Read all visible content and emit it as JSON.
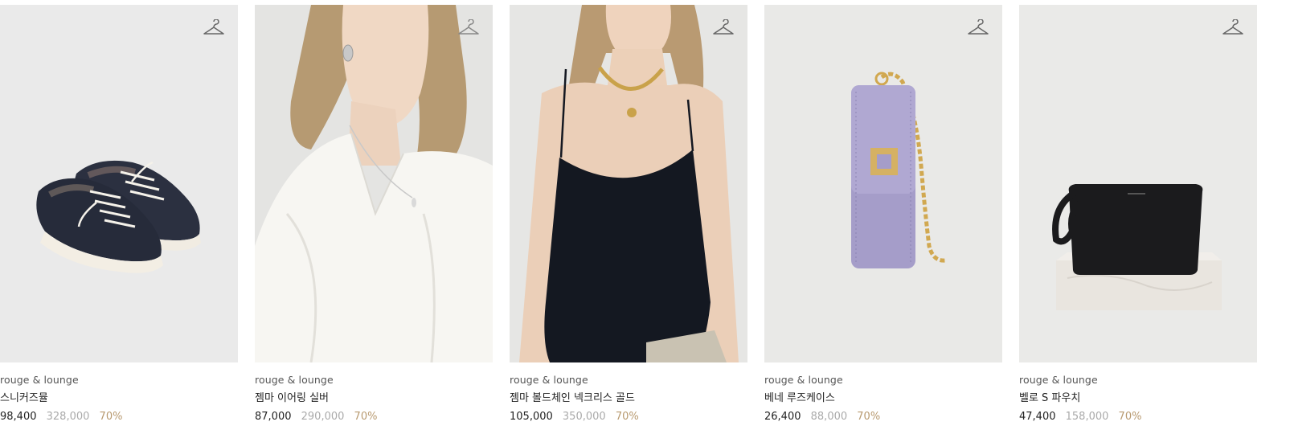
{
  "products": [
    {
      "brand": "rouge & lounge",
      "name": "스니커즈뮬",
      "sale_price": "98,400",
      "original_price": "328,000",
      "discount": "70%",
      "image_bg": "#eaeaea",
      "wishlist_icon": "hanger-icon"
    },
    {
      "brand": "rouge & lounge",
      "name": "젬마 이어링 실버",
      "sale_price": "87,000",
      "original_price": "290,000",
      "discount": "70%",
      "image_bg": "#e4e4e2",
      "wishlist_icon": "hanger-icon"
    },
    {
      "brand": "rouge & lounge",
      "name": "젬마 볼드체인 넥크리스 골드",
      "sale_price": "105,000",
      "original_price": "350,000",
      "discount": "70%",
      "image_bg": "#e6e6e4",
      "wishlist_icon": "hanger-icon"
    },
    {
      "brand": "rouge & lounge",
      "name": "베네 루즈케이스",
      "sale_price": "26,400",
      "original_price": "88,000",
      "discount": "70%",
      "image_bg": "#e9e9e7",
      "wishlist_icon": "hanger-icon"
    },
    {
      "brand": "rouge & lounge",
      "name": "벨로 S 파우치",
      "sale_price": "47,400",
      "original_price": "158,000",
      "discount": "70%",
      "image_bg": "#eaeae8",
      "wishlist_icon": "hanger-icon"
    }
  ],
  "colors": {
    "discount": "#b89a70",
    "original_price": "#aaaaaa",
    "text": "#222222"
  }
}
